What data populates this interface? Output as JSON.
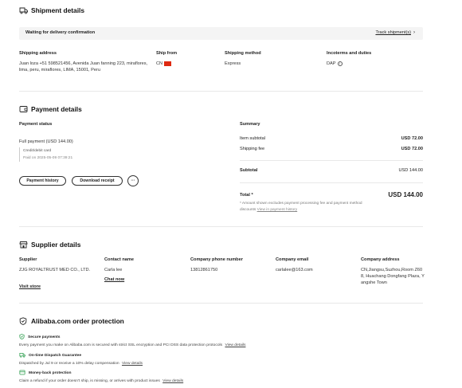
{
  "shipment": {
    "title": "Shipment details",
    "status": "Waiting for delivery confirmation",
    "track_link": "Track shipment(s)",
    "columns": {
      "address_label": "Shipping address",
      "address_value": "Juan loza +51 598521456, Avenida Juan fanning 223, miraflores, lima, peru, miraflores, LIMA, 15001, Peru",
      "ship_from_label": "Ship from",
      "ship_from_value": "CN",
      "method_label": "Shipping method",
      "method_value": "Express",
      "incoterms_label": "Incoterms and duties",
      "incoterms_value": "DAP"
    }
  },
  "payment": {
    "title": "Payment details",
    "status_label": "Payment status",
    "full_payment": "Full payment  (USD 144.00)",
    "method": "Credit/debit card",
    "paid_on": "Paid on 2025-05-09 07:39:21",
    "btn_history": "Payment history",
    "btn_receipt": "Download receipt",
    "btn_more": "···",
    "summary_label": "Summary",
    "item_subtotal_label": "Item subtotal",
    "item_subtotal_value": "USD 72.00",
    "shipping_fee_label": "Shipping fee",
    "shipping_fee_value": "USD 72.00",
    "subtotal_label": "Subtotal",
    "subtotal_value": "USD 144.00",
    "total_label": "Total *",
    "total_value": "USD 144.00",
    "note_line1": "* Amount shown excludes payment processing fee and payment method",
    "note_line2": "discounts",
    "note_link": "View in payment history"
  },
  "supplier": {
    "title": "Supplier details",
    "supplier_label": "Supplier",
    "supplier_value": "ZJG ROYALTRUST MED CO., LTD.",
    "visit_store": "Visit store",
    "contact_label": "Contact name",
    "contact_value": "Carla lee",
    "chat_now": "Chat now",
    "phone_label": "Company phone number",
    "phone_value": "13812861750",
    "email_label": "Company email",
    "email_value": "carlalee@163.com",
    "address_label": "Company address",
    "address_value": "CN,Jiangsu,Suzhou,Room Z608, Huachang Dongfang Plaza, Yangshe Town"
  },
  "protection": {
    "title": "Alibaba.com order protection",
    "items": [
      {
        "title": "Secure payments",
        "desc": "Every payment you make on Alibaba.com is secured with strict SSL encryption and PCI DSS data protection protocols",
        "link": "View details"
      },
      {
        "title": "On-time Dispatch Guarantee",
        "desc": "Dispatched by Jul 9 or receive a 10% delay compensation",
        "link": "View details"
      },
      {
        "title": "Money-back protection",
        "desc": "Claim a refund if your order doesn't ship, is missing, or arrives with product issues",
        "link": "View details"
      }
    ]
  },
  "colors": {
    "accent_green": "#2e9e4f",
    "flag_red": "#de2910",
    "status_bar": "#f4f4f4"
  }
}
